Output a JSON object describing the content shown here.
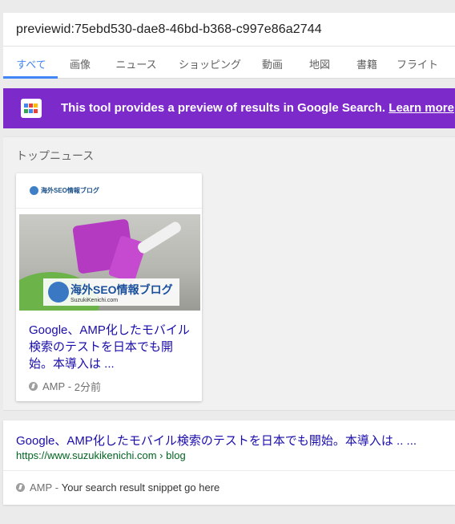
{
  "search": {
    "query": "previewid:75ebd530-dae8-46bd-b368-c997e86a2744"
  },
  "tabs": [
    {
      "label": "すべて",
      "active": true
    },
    {
      "label": "画像"
    },
    {
      "label": "ニュース"
    },
    {
      "label": "ショッピング"
    },
    {
      "label": "動画"
    },
    {
      "label": "地図"
    },
    {
      "label": "書籍"
    },
    {
      "label": "フライト"
    }
  ],
  "banner": {
    "text": "This tool provides a preview of results in Google Search.",
    "link": "Learn more",
    "suffix": ".",
    "color": "#7c2aca"
  },
  "top_news": {
    "heading": "トップニュース",
    "card": {
      "publisher": "海外SEO情報ブログ",
      "image_caption": "海外SEO情報ブログ",
      "image_subcaption": "SuzukiKenichi.com",
      "title": "Google、AMP化したモバイル検索のテストを日本でも開始。本導入は ...",
      "amp_label": "AMP",
      "time": "2分前"
    }
  },
  "result": {
    "title": "Google、AMP化したモバイル検索のテストを日本でも開始。本導入は .. ...",
    "url": "https://www.suzukikenichi.com › blog",
    "amp_label": "AMP",
    "snippet": "Your search result snippet go here"
  },
  "colors": {
    "accent": "#4285f4",
    "link": "#1a0dab",
    "url": "#006621"
  }
}
